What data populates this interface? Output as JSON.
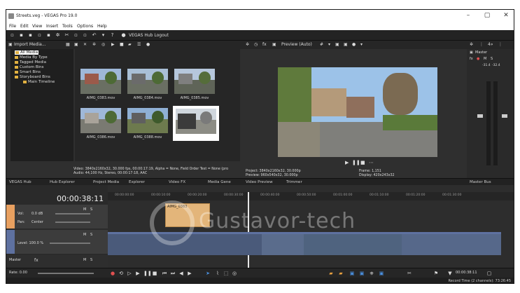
{
  "window": {
    "title": "Streets.veg - VEGAS Pro 19.0"
  },
  "menu": [
    "File",
    "Edit",
    "View",
    "Insert",
    "Tools",
    "Options",
    "Help"
  ],
  "toolbar": {
    "hub_logout": "VEGAS Hub Logout"
  },
  "project_media": {
    "import_label": "Import Media...",
    "tree": [
      "All Media",
      "Media By Type",
      "Tagged Media",
      "Custom Bins",
      "Smart Bins",
      "Storyboard Bins",
      "Main Timeline"
    ],
    "thumbnails": [
      "AIMG_0383.mov",
      "AIMG_0384.mov",
      "AIMG_0385.mov",
      "AIMG_0386.mov",
      "AIMG_0388.mov",
      ""
    ],
    "info_line1": "Video: 3840x2160x32, 30.000 fps, 00:00:17:19, Alpha = None, Field Order Test = None (pro",
    "info_line2": "Audio: 44,100 Hz, Stereo, 00:00:17:18, AAC"
  },
  "preview": {
    "label": "Preview (Auto)",
    "project": "Project:  3840x2160x32, 30.000p",
    "preview_res": "Preview:  960x540x32, 30.000p",
    "frame": "Frame:     1,151",
    "display": "Display:    420x243x32"
  },
  "master": {
    "label": "Master",
    "m": "M",
    "s": "S",
    "db_left": "-31.4",
    "db_right": "-32.4"
  },
  "dock_tabs": [
    "VEGAS Hub",
    "Hub Explorer",
    "Project Media",
    "Explorer",
    "Video FX",
    "Media Gene",
    "Video Preview",
    "Trimmer",
    "Master Bus"
  ],
  "timeline": {
    "timecode": "00:00:38:11",
    "ruler": [
      "00:00:00:00",
      "00:00:10:00",
      "00:00:20:00",
      "00:00:30:00",
      "00:00:40:00",
      "00:00:50:00",
      "00:01:00:00",
      "00:01:10:00",
      "00:01:20:00",
      "00:01:30:00"
    ],
    "audio_track": {
      "vol_label": "Vol:",
      "vol_value": "0.0 dB",
      "pan_label": "Pan:",
      "pan_value": "Center"
    },
    "video_track": {
      "level_label": "Level: 100.0 %"
    },
    "audio_clip_label": "AIMG_0383",
    "master_label": "Master",
    "rate": "Rate: 0.00",
    "bottom_timecode": "00:00:38:11"
  },
  "status": {
    "record_time": "Record Time (2 channels): 73:26:45"
  },
  "watermark": "Gustavor-tech"
}
